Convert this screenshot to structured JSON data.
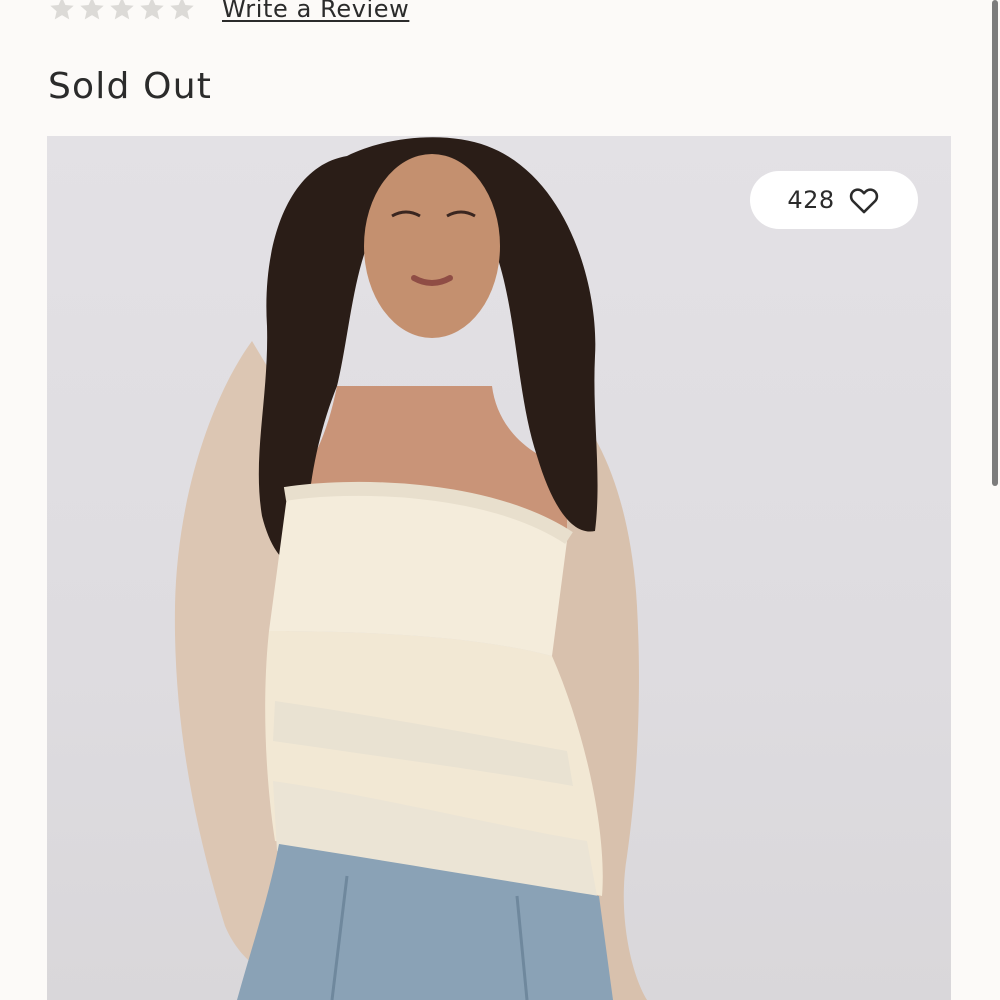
{
  "rating": {
    "stars": 5,
    "filled_stars": 0,
    "write_review_label": "Write a Review",
    "star_color": "#dcdad7"
  },
  "status": {
    "label": "Sold Out"
  },
  "product_image": {
    "like_count": "428",
    "icon": "heart-outline-icon",
    "background_color": "#e0dee2"
  },
  "colors": {
    "page_background": "#fcfaf8",
    "text": "#2b2b2b"
  }
}
